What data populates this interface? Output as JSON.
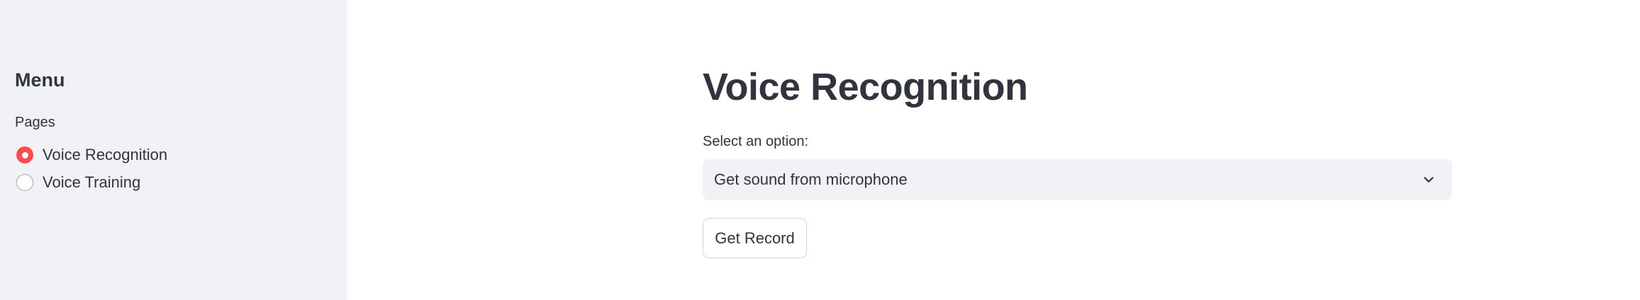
{
  "sidebar": {
    "title": "Menu",
    "radio_group_label": "Pages",
    "options": [
      {
        "label": "Voice Recognition",
        "selected": true
      },
      {
        "label": "Voice Training",
        "selected": false
      }
    ]
  },
  "main": {
    "title": "Voice Recognition",
    "select": {
      "label": "Select an option:",
      "value": "Get sound from microphone"
    },
    "button_label": "Get Record"
  },
  "colors": {
    "sidebar_bg": "#f0f2f6",
    "accent": "#ff4b4b",
    "text": "#31333f"
  },
  "icons": {
    "select_chevron": "chevron-down-icon"
  }
}
